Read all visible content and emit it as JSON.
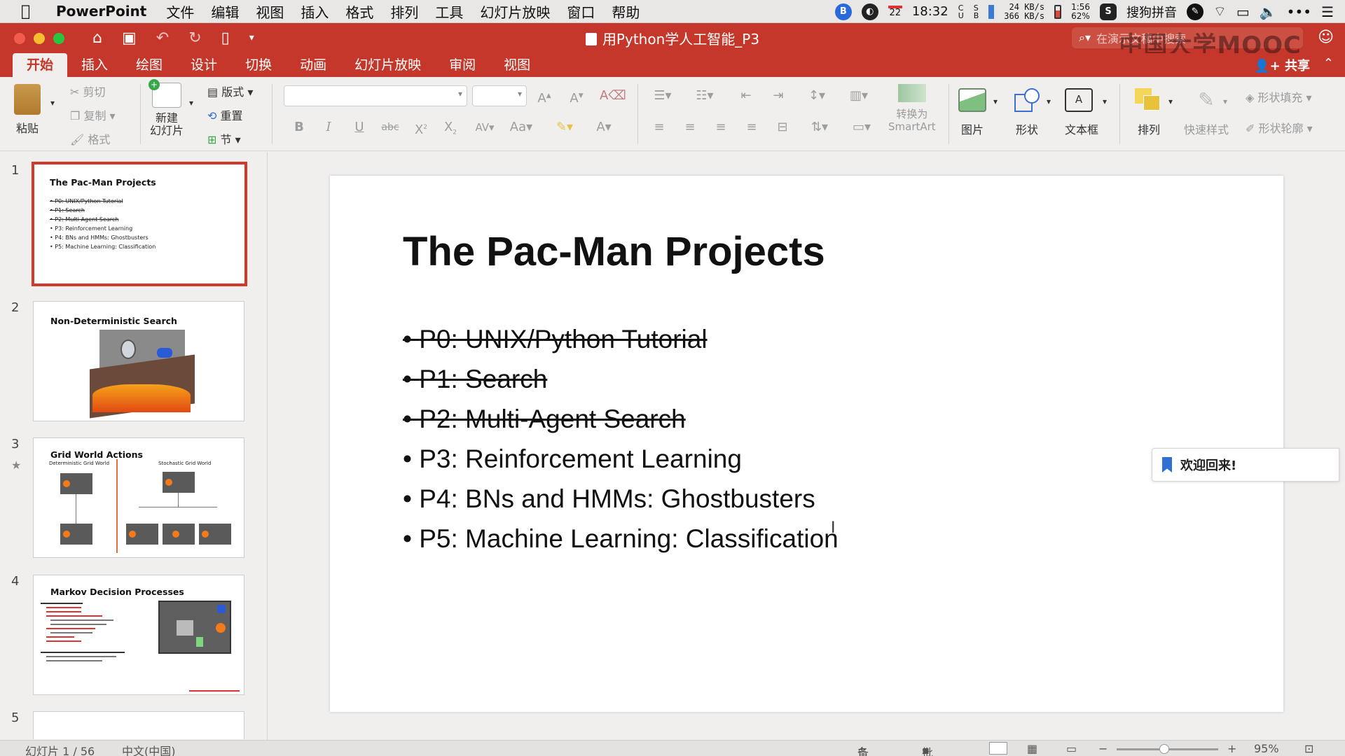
{
  "menubar": {
    "app_name": "PowerPoint",
    "items": [
      "文件",
      "编辑",
      "视图",
      "插入",
      "格式",
      "排列",
      "工具",
      "幻灯片放映",
      "窗口",
      "帮助"
    ],
    "date_badge": "22",
    "time": "18:32",
    "net_up": "24 KB/s",
    "net_down": "366 KB/s",
    "battery_time": "1:56",
    "battery_pct": "62%",
    "ime": "搜狗拼音"
  },
  "titlebar": {
    "doc_title": "用Python学人工智能_P3",
    "search_placeholder": "在演示文稿中搜索",
    "watermark": "中国大学MOOC"
  },
  "tabs": {
    "items": [
      "开始",
      "插入",
      "绘图",
      "设计",
      "切换",
      "动画",
      "幻灯片放映",
      "审阅",
      "视图"
    ],
    "active_index": 0,
    "share": "共享"
  },
  "ribbon": {
    "paste": "粘贴",
    "cut": "剪切",
    "copy": "复制",
    "format": "格式",
    "new_slide_1": "新建",
    "new_slide_2": "幻灯片",
    "layout": "版式",
    "reset": "重置",
    "section": "节",
    "smartart_1": "转换为",
    "smartart_2": "SmartArt",
    "picture": "图片",
    "shape": "形状",
    "textbox": "文本框",
    "arrange": "排列",
    "quick_styles": "快速样式",
    "shape_fill": "形状填充",
    "shape_outline": "形状轮廓"
  },
  "thumbnails": [
    {
      "num": "1",
      "title": "The Pac-Man Projects",
      "lines": [
        {
          "text": "• P0: UNIX/Python Tutorial",
          "strike": true
        },
        {
          "text": "• P1: Search",
          "strike": true
        },
        {
          "text": "• P2: Multi-Agent Search",
          "strike": true
        },
        {
          "text": "• P3: Reinforcement Learning",
          "strike": false
        },
        {
          "text": "• P4: BNs and HMMs: Ghostbusters",
          "strike": false
        },
        {
          "text": "• P5: Machine Learning: Classification",
          "strike": false
        }
      ]
    },
    {
      "num": "2",
      "title": "Non-Deterministic Search"
    },
    {
      "num": "3",
      "title": "Grid World Actions",
      "label_left": "Deterministic Grid World",
      "label_right": "Stochastic Grid World"
    },
    {
      "num": "4",
      "title": "Markov Decision Processes"
    },
    {
      "num": "5",
      "title": ""
    }
  ],
  "slide": {
    "title": "The Pac-Man Projects",
    "bullets": [
      {
        "text": "P0: UNIX/Python Tutorial",
        "strike": true
      },
      {
        "text": "P1: Search",
        "strike": true
      },
      {
        "text": "P2: Multi-Agent Search",
        "strike": true
      },
      {
        "text": "P3: Reinforcement Learning",
        "strike": false
      },
      {
        "text": "P4: BNs and HMMs: Ghostbusters",
        "strike": false
      },
      {
        "text": "P5: Machine Learning: Classification",
        "strike": false
      }
    ]
  },
  "welcome_panel": {
    "text": "欢迎回来!"
  },
  "status": {
    "slide_counter": "幻灯片 1 / 56",
    "language": "中文(中国)",
    "notes": "备注",
    "comments": "批注",
    "zoom": "95%"
  },
  "colors": {
    "accent": "#c4372a",
    "selection": "#d1392b"
  }
}
